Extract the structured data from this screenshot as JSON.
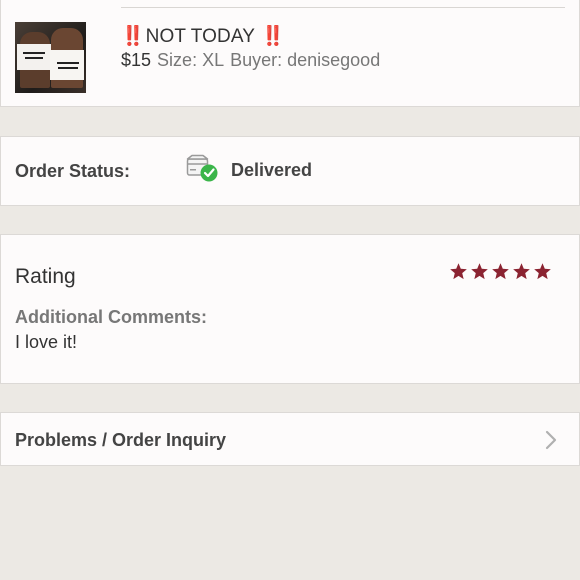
{
  "item": {
    "title_prefix": "‼️",
    "title_text": "NOT TODAY",
    "title_suffix": "‼️",
    "price": "$15",
    "size": "Size: XL",
    "buyer": "Buyer: denisegood"
  },
  "order_status": {
    "label": "Order Status:",
    "value": "Delivered",
    "icon": "delivered-box-icon"
  },
  "rating": {
    "title": "Rating",
    "stars": 5,
    "max_stars": 5,
    "star_color": "#8b2331",
    "comments_label": "Additional Comments:",
    "comments_text": "I love it!"
  },
  "problems": {
    "label": "Problems / Order Inquiry",
    "icon": "chevron-right-icon"
  },
  "colors": {
    "background": "#ece9e4",
    "card": "#fdfbfb",
    "accent_red": "#e0262a",
    "check_green": "#3bb54a"
  }
}
